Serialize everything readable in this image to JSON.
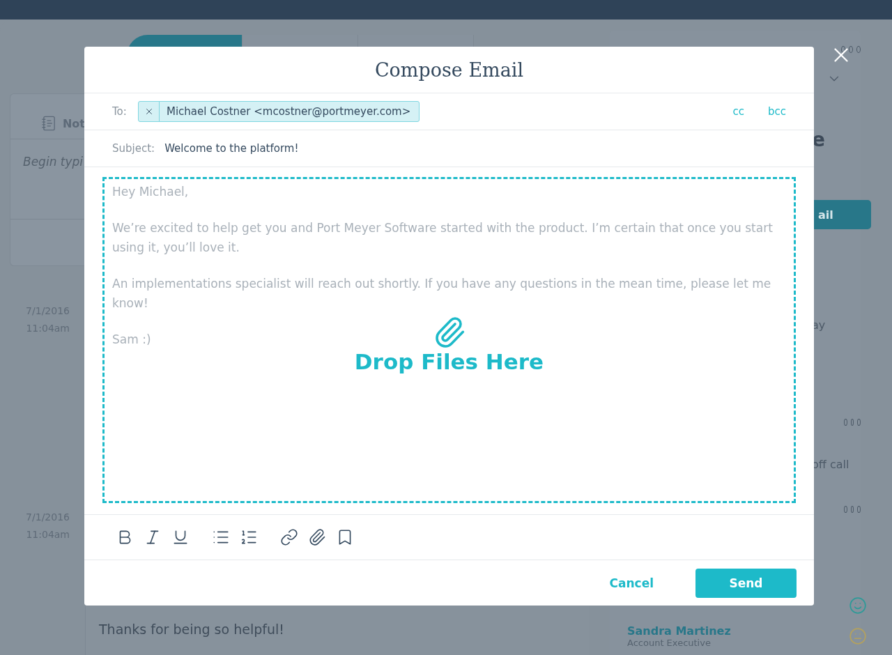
{
  "background": {
    "notes_tab": "Not",
    "notes_placeholder": "Begin typi",
    "timestamps": [
      {
        "date": "7/1/2016",
        "time": "11:04am"
      },
      {
        "date": "7/1/2016",
        "time": "11:04am"
      }
    ],
    "heading_fragment": "e",
    "button_fragment": "ail",
    "text_fragments": [
      "ay",
      "off call"
    ],
    "message": "Thanks for being so helpful!",
    "tabs": [
      {
        "selected": true
      },
      {
        "selected": false
      },
      {
        "selected": false
      }
    ],
    "contacts": [
      {
        "kind": "happy"
      },
      {
        "name": "Sandra Martinez",
        "title": "Account Executive",
        "kind": "neutral"
      }
    ]
  },
  "modal": {
    "title": "Compose Email",
    "to_label": "To:",
    "recipients": [
      {
        "text": "Michael Costner <mcostner@portmeyer.com>"
      }
    ],
    "cc": "cc",
    "bcc": "bcc",
    "subject_label": "Subject:",
    "subject": "Welcome to the platform!",
    "body": [
      "Hey Michael,",
      "We’re excited to help get you and Port Meyer Software started with the product. I’m certain that once you start using it, you’ll love it.",
      "An implementations specialist will reach out shortly. If you have any questions in the mean time, please let me know!",
      "Sam :)"
    ],
    "drop_zone": "Drop Files Here",
    "toolbar": [
      {
        "kind": "bold"
      },
      {
        "kind": "italic"
      },
      {
        "kind": "underline"
      },
      {
        "kind": "bullets"
      },
      {
        "kind": "numbers"
      },
      {
        "kind": "link"
      },
      {
        "kind": "attach"
      },
      {
        "kind": "bookmark"
      }
    ],
    "cancel": "Cancel",
    "send": "Send"
  }
}
